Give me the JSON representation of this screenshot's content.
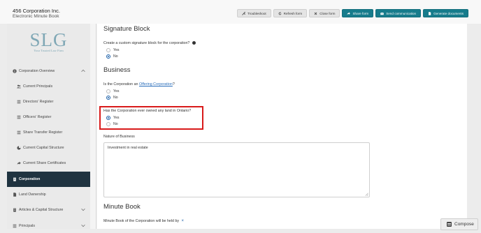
{
  "header": {
    "company": "456 Corporation Inc.",
    "subtitle": "Electronic Minute Book"
  },
  "toolbar": {
    "troubleshoot": "Troubleshoot",
    "refresh_form": "Refresh form",
    "close_form": "Close form",
    "share_form": "Share form",
    "send_communication": "Send communication",
    "generate_documents": "Generate documents"
  },
  "logo": {
    "text": "SLG",
    "tagline": "Your Trusted Law Firm"
  },
  "sidebar": {
    "items": [
      {
        "label": "Corporation Overview"
      },
      {
        "label": "Current Principals"
      },
      {
        "label": "Directors' Register"
      },
      {
        "label": "Officers' Register"
      },
      {
        "label": "Share Transfer Register"
      },
      {
        "label": "Current Capital Structure"
      },
      {
        "label": "Current Share Certificates"
      },
      {
        "label": "Corporation"
      },
      {
        "label": "Land Ownership"
      },
      {
        "label": "Articles & Capital Structure"
      },
      {
        "label": "Principals"
      }
    ]
  },
  "main": {
    "signature": {
      "heading": "Signature Block",
      "question": "Create a custom signature block for the corporation?",
      "yes": "Yes",
      "no": "No",
      "selected": "No"
    },
    "business": {
      "heading": "Business",
      "offering_prefix": "Is the Corporation an ",
      "offering_link": "Offering Corporation",
      "offering_suffix": "?",
      "yes": "Yes",
      "no": "No",
      "offering_selected": "No",
      "land_question": "Has the Corporation ever owned any land in Ontario?",
      "land_selected": "Yes",
      "nature_label": "Nature of Business",
      "nature_value": "Investment in real estate"
    },
    "minute_book": {
      "heading": "Minute Book",
      "question": "Minute Book of the Corporation will be held by",
      "x_mark": "×"
    }
  },
  "compose": {
    "label": "Compose"
  },
  "colors": {
    "teal": "#177c8c",
    "sidebar_active": "#1f3340",
    "highlight": "#d81a1a",
    "link": "#2a6ebb"
  }
}
